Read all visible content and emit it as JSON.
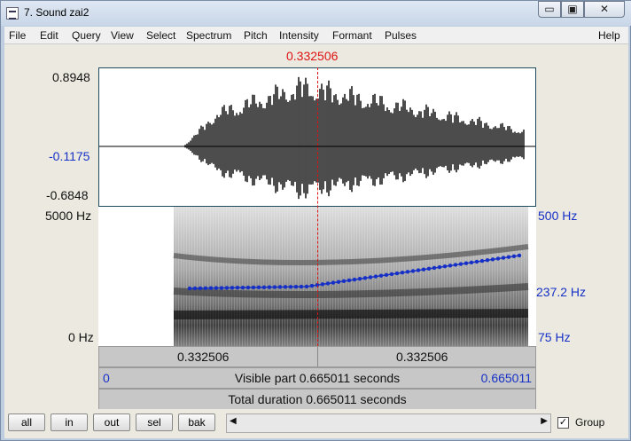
{
  "window": {
    "title": "7. Sound zai2"
  },
  "title_buttons": {
    "minimize": "▭",
    "maximize": "▣",
    "close": "✕"
  },
  "menu": [
    "File",
    "Edit",
    "Query",
    "View",
    "Select",
    "Spectrum",
    "Pitch",
    "Intensity",
    "Formant",
    "Pulses",
    "Help"
  ],
  "cursor": {
    "time_label": "0.332506",
    "time_fraction": 0.5
  },
  "waveform": {
    "y_max": "0.8948",
    "y_cursor": "-0.1175",
    "y_min": "-0.6848"
  },
  "spectrogram": {
    "freq_max": "5000 Hz",
    "freq_min": "0 Hz",
    "pitch_max": "500 Hz",
    "pitch_cursor": "237.2 Hz",
    "pitch_min": "75 Hz"
  },
  "time_bar": {
    "left": "0.332506",
    "right": "0.332506"
  },
  "visible_bar": {
    "start": "0",
    "text": "Visible part 0.665011 seconds",
    "end": "0.665011"
  },
  "total_bar": {
    "text": "Total duration 0.665011 seconds"
  },
  "buttons": {
    "all": "all",
    "in": "in",
    "out": "out",
    "sel": "sel",
    "bak": "bak"
  },
  "scroll": {
    "left_arrow": "◀",
    "right_arrow": "▶"
  },
  "group": {
    "label": "Group",
    "checked": true,
    "check_mark": "✓"
  },
  "colors": {
    "cursor": "#dd1111",
    "pitch": "#1630c7",
    "waveform": "#000000"
  }
}
